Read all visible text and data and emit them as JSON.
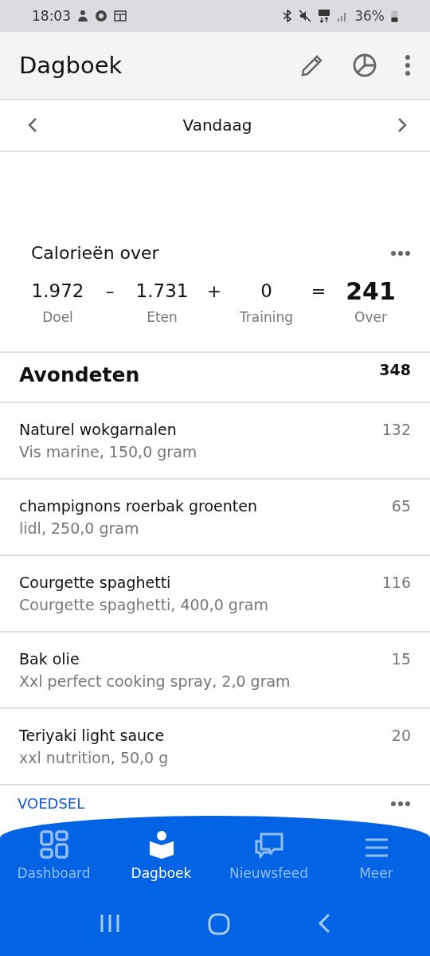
{
  "status_bar": {
    "time": "18:03",
    "battery": "36%"
  },
  "app_bar": {
    "title": "Dagboek"
  },
  "date_nav": {
    "label": "Vandaag"
  },
  "calories": {
    "title": "Calorieën over",
    "terms": [
      {
        "value": "1.972",
        "label": "Doel",
        "operator": "–"
      },
      {
        "value": "1.731",
        "label": "Eten",
        "operator": "+"
      },
      {
        "value": "0",
        "label": "Training",
        "operator": "="
      },
      {
        "value": "241",
        "label": "Over"
      }
    ]
  },
  "meal": {
    "title": "Avondeten",
    "total": "348",
    "items": [
      {
        "name": "Naturel wokgarnalen",
        "detail": "Vis marine, 150,0 gram",
        "calories": "132"
      },
      {
        "name": "champignons roerbak groenten",
        "detail": "lidl, 250,0 gram",
        "calories": "65"
      },
      {
        "name": "Courgette spaghetti",
        "detail": "Courgette spaghetti, 400,0 gram",
        "calories": "116"
      },
      {
        "name": "Bak olie",
        "detail": "Xxl perfect cooking spray, 2,0 gram",
        "calories": "15"
      },
      {
        "name": "Teriyaki light sauce",
        "detail": "xxl nutrition, 50,0 g",
        "calories": "20"
      }
    ],
    "add_label": "VOEDSEL"
  },
  "bottom_nav": [
    {
      "label": "Dashboard",
      "kind": "dashboard",
      "selected": false
    },
    {
      "label": "Dagboek",
      "kind": "diary",
      "selected": true
    },
    {
      "label": "Nieuwsfeed",
      "kind": "news",
      "selected": false
    },
    {
      "label": "Meer",
      "kind": "more",
      "selected": false
    }
  ]
}
